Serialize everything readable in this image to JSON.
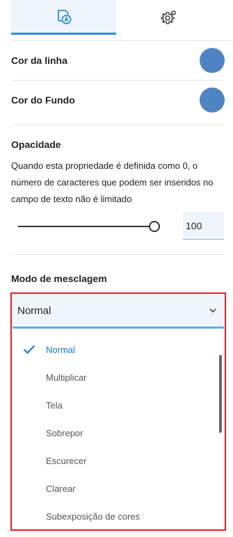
{
  "tabs": [
    {
      "icon": "text-style-icon",
      "active": true
    },
    {
      "icon": "gear-icon",
      "active": false
    }
  ],
  "line_color": {
    "label": "Cor da linha",
    "color": "#4f83c2"
  },
  "background_color": {
    "label": "Cor do Fundo",
    "color": "#4f83c2"
  },
  "opacity": {
    "title": "Opacidade",
    "description": "Quando esta propriedade é definida como 0, o número de caracteres que podem ser inseridos no campo de texto não é limitado",
    "slider_level": 1.0,
    "value": "100"
  },
  "blend_mode": {
    "title": "Modo de mesclagem",
    "selected": "Normal",
    "options": [
      "Normal",
      "Multiplicar",
      "Tela",
      "Sobrepor",
      "Escurecer",
      "Clarear",
      "Subexposição de cores"
    ],
    "selected_index": 0
  },
  "colors": {
    "accent": "#2d8fd8",
    "highlight_frame": "#e11b22",
    "selected_text": "#1a73c7"
  }
}
